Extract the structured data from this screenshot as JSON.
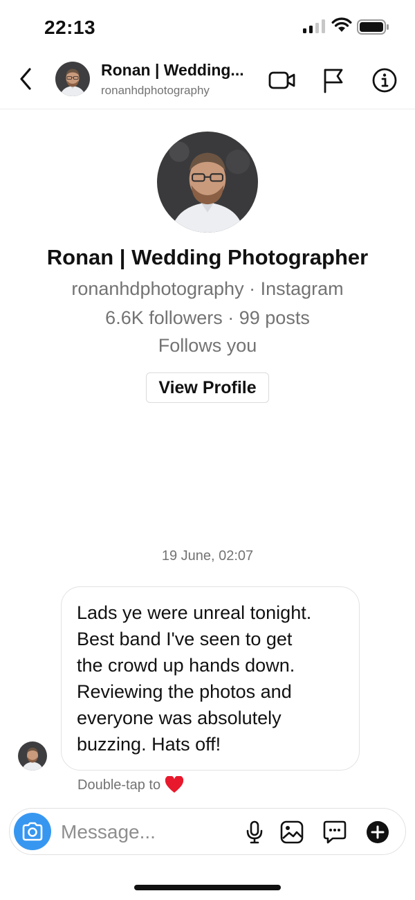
{
  "status_bar": {
    "time": "22:13"
  },
  "header": {
    "name": "Ronan | Wedding...",
    "handle": "ronanhdphotography"
  },
  "profile": {
    "name": "Ronan | Wedding Photographer",
    "handle_line": "ronanhdphotography · Instagram",
    "stats_line": "6.6K followers · 99 posts",
    "follow_status": "Follows you",
    "view_profile_label": "View Profile"
  },
  "thread": {
    "timestamp": "19 June, 02:07",
    "messages": [
      {
        "text": "Lads ye were unreal tonight.\nBest band I've seen to get\nthe crowd up hands down.\nReviewing the photos and\neveryone was absolutely\nbuzzing. Hats off!"
      }
    ],
    "double_tap_hint": "Double-tap to"
  },
  "composer": {
    "placeholder": "Message..."
  },
  "colors": {
    "accent": "#3797f0",
    "heart": "#e8192c",
    "secondary_text": "#737373"
  },
  "icons": [
    "back-chevron-icon",
    "video-call-icon",
    "flag-icon",
    "info-icon",
    "camera-icon",
    "microphone-icon",
    "gallery-icon",
    "sticker-icon",
    "plus-icon",
    "heart-icon"
  ]
}
